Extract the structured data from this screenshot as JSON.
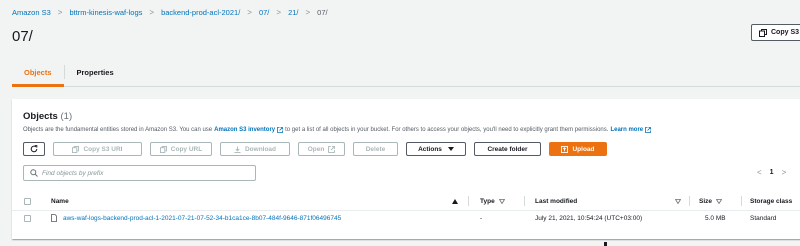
{
  "breadcrumb": {
    "items": [
      "Amazon S3",
      "bttrm-kinesis-waf-logs",
      "backend-prod-acl-2021/",
      "07/",
      "21/",
      "07/"
    ],
    "separator": ">"
  },
  "page": {
    "title": "07/"
  },
  "header_actions": {
    "copy_s3_uri": "Copy S3"
  },
  "tabs": [
    {
      "label": "Objects",
      "active": true
    },
    {
      "label": "Properties",
      "active": false
    }
  ],
  "objects_panel": {
    "title": "Objects",
    "count": "(1)",
    "description": {
      "before": "Objects are the fundamental entities stored in Amazon S3. You can use",
      "inventory_link": "Amazon S3 inventory",
      "middle": "to get a list of all objects in your bucket. For others to access your objects, you'll need to explicitly grant them permissions.",
      "learn_more": "Learn more"
    },
    "toolbar": {
      "copy_s3_uri": "Copy S3 URI",
      "copy_url": "Copy URL",
      "download": "Download",
      "open": "Open",
      "delete": "Delete",
      "actions": "Actions",
      "create_folder": "Create folder",
      "upload": "Upload"
    },
    "filter": {
      "placeholder": "Find objects by prefix",
      "value": ""
    },
    "pagination": {
      "current_page": "1",
      "prev": "<",
      "next": ">"
    },
    "table": {
      "columns": [
        "Name",
        "Type",
        "Last modified",
        "Size",
        "Storage class"
      ],
      "rows": [
        {
          "name": "aws-waf-logs-backend-prod-acl-1-2021-07-21-07-52-34-b1ca1ce-8b07-484f-9646-871f06496745",
          "type": "-",
          "last_modified": "July 21, 2021, 10:54:24 (UTC+03:00)",
          "size": "5.0 MB",
          "storage_class": "Standard"
        }
      ]
    }
  },
  "colors": {
    "accent": "#ec7211",
    "link": "#0073bb",
    "background": "#f2f3f3",
    "text": "#16191f"
  }
}
